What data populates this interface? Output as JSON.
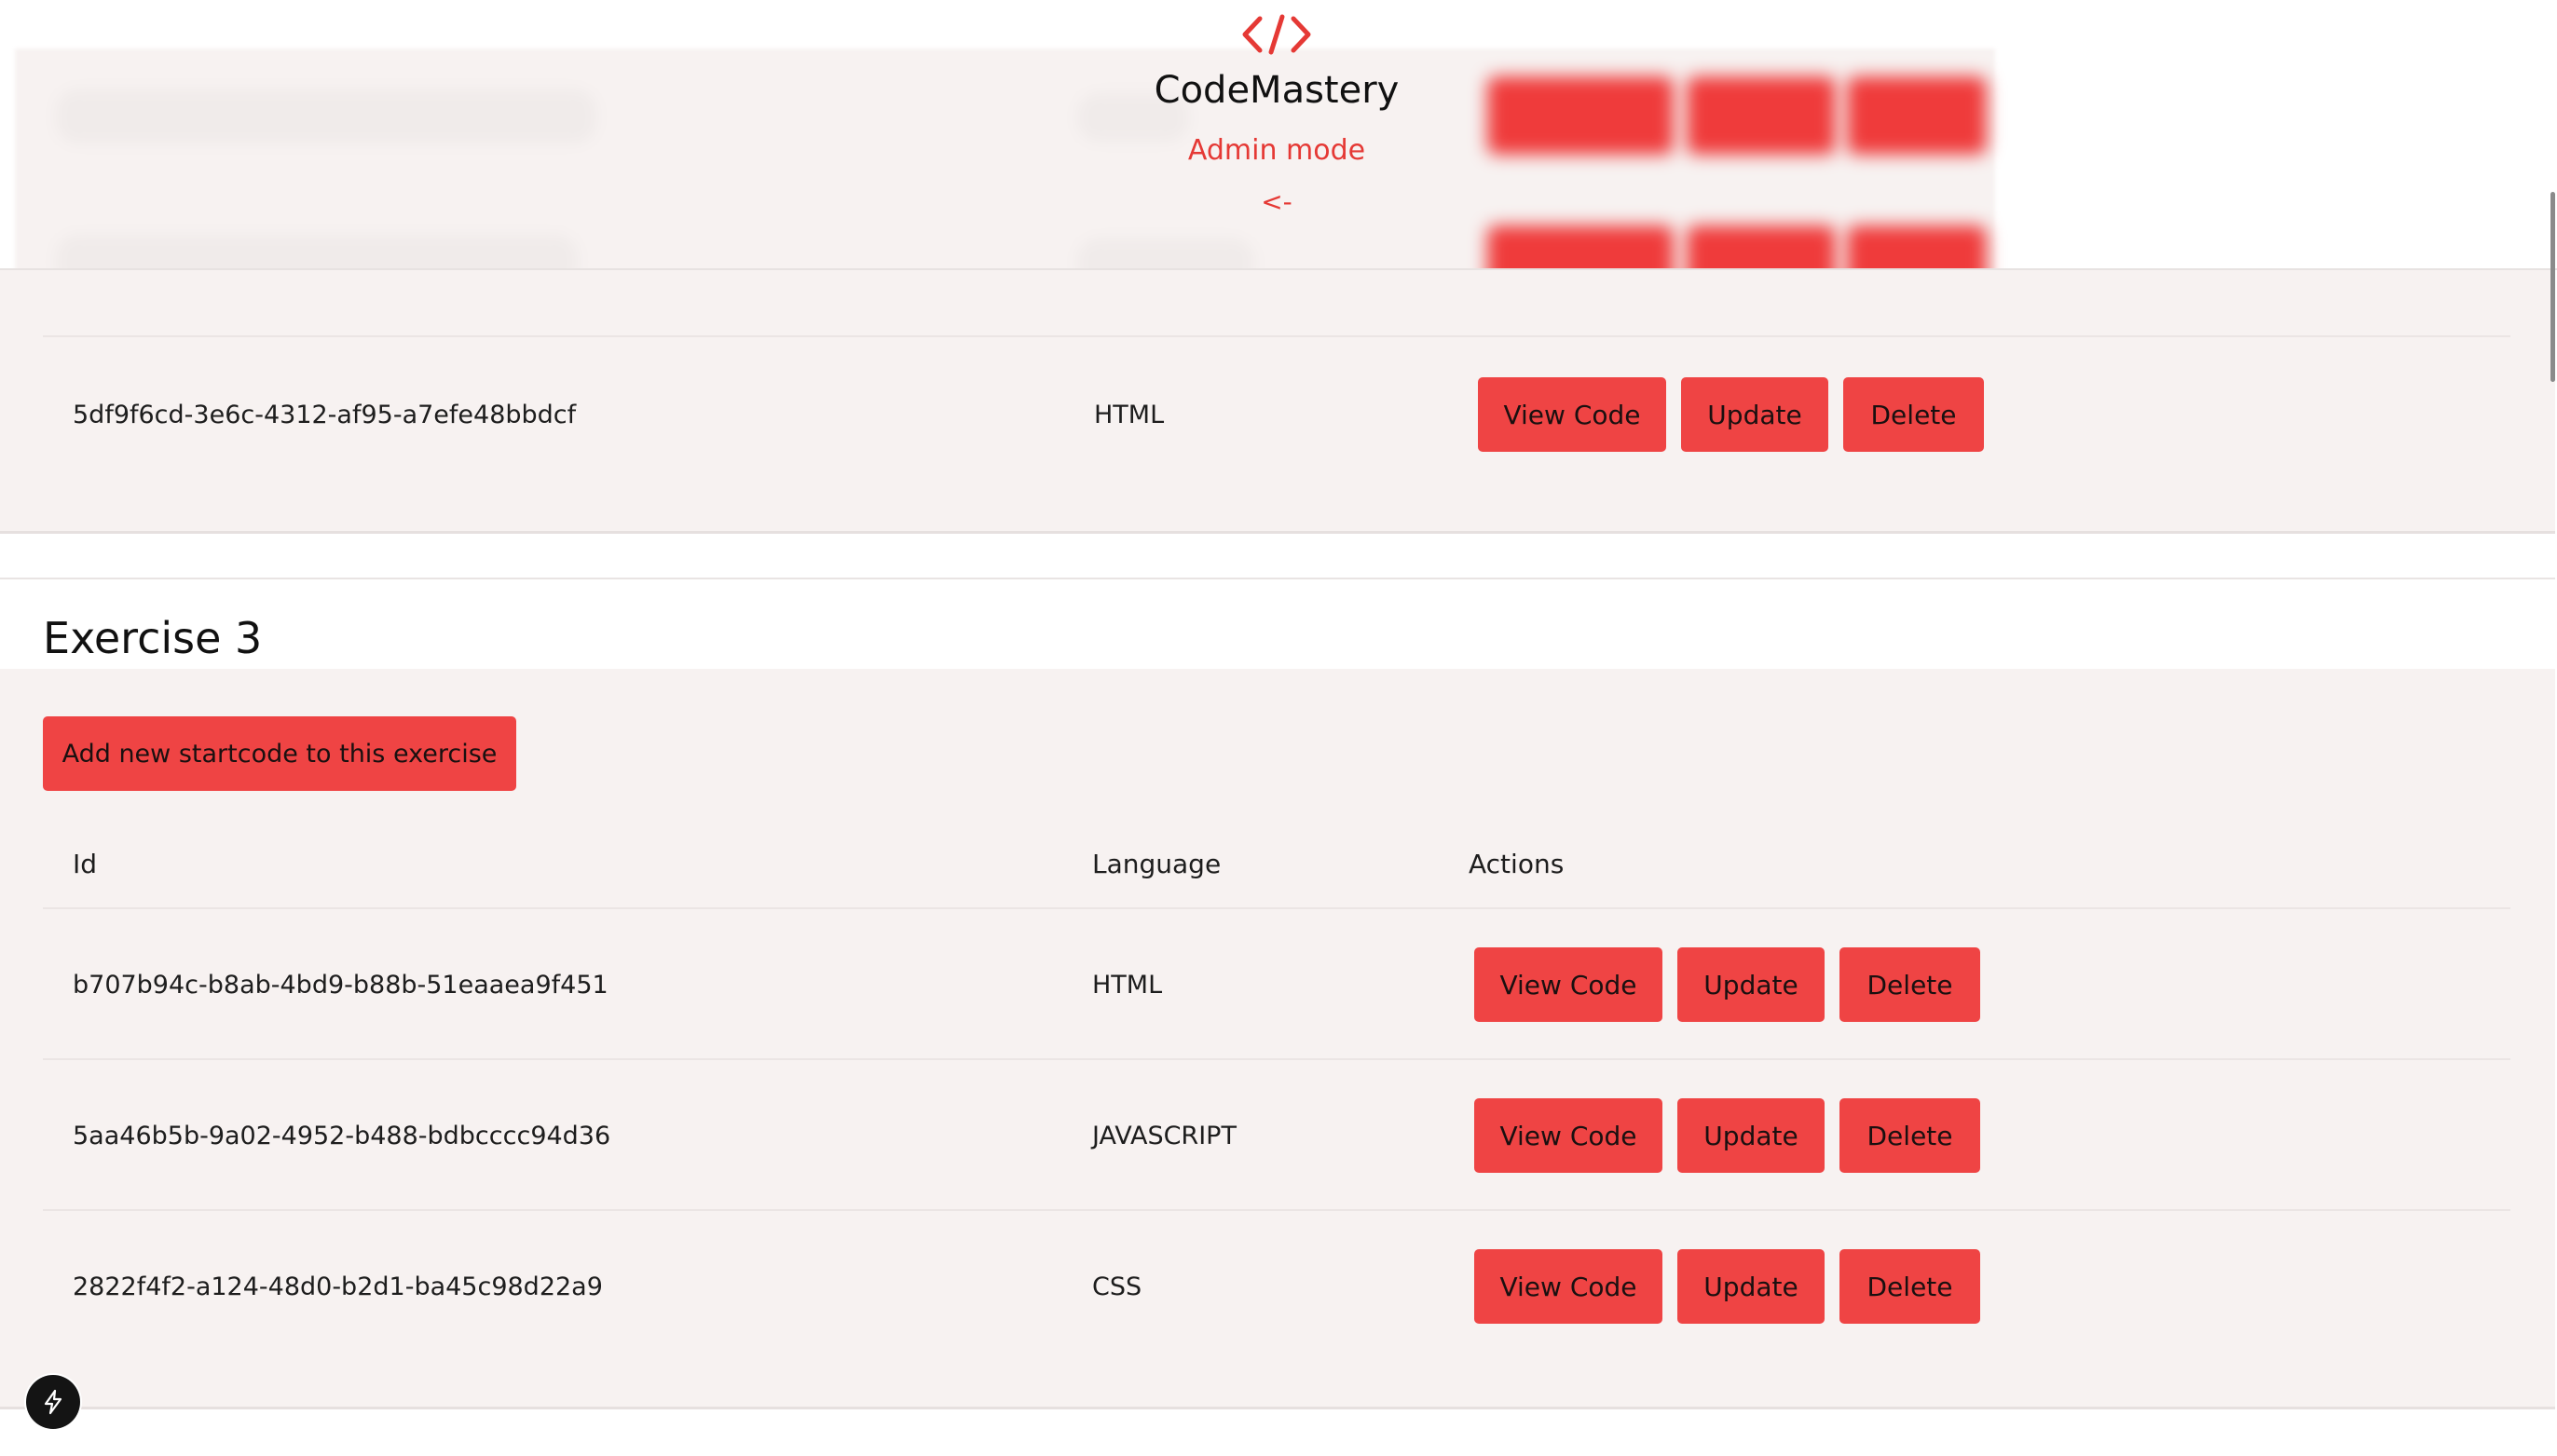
{
  "brand": {
    "logo_icon": "code-brackets-icon",
    "name": "CodeMastery",
    "mode": "Admin mode",
    "back_label": "<-"
  },
  "colors": {
    "accent": "#ef4444",
    "accent_text": "#e53935",
    "card_bg": "#f7f2f1"
  },
  "previous_exercise": {
    "rows": [
      {
        "id": "5df9f6cd-3e6c-4312-af95-a7efe48bbdcf",
        "language": "HTML",
        "actions": [
          "View Code",
          "Update",
          "Delete"
        ]
      }
    ]
  },
  "exercise": {
    "title": "Exercise 3",
    "add_button_label": "Add new startcode to this exercise",
    "table": {
      "headers": [
        "Id",
        "Language",
        "Actions"
      ],
      "rows": [
        {
          "id": "b707b94c-b8ab-4bd9-b88b-51eaaea9f451",
          "language": "HTML",
          "actions": [
            "View Code",
            "Update",
            "Delete"
          ]
        },
        {
          "id": "5aa46b5b-9a02-4952-b488-bdbcccc94d36",
          "language": "JAVASCRIPT",
          "actions": [
            "View Code",
            "Update",
            "Delete"
          ]
        },
        {
          "id": "2822f4f2-a124-48d0-b2d1-ba45c98d22a9",
          "language": "CSS",
          "actions": [
            "View Code",
            "Update",
            "Delete"
          ]
        }
      ]
    }
  },
  "dev_tools_icon": "lightning-icon"
}
